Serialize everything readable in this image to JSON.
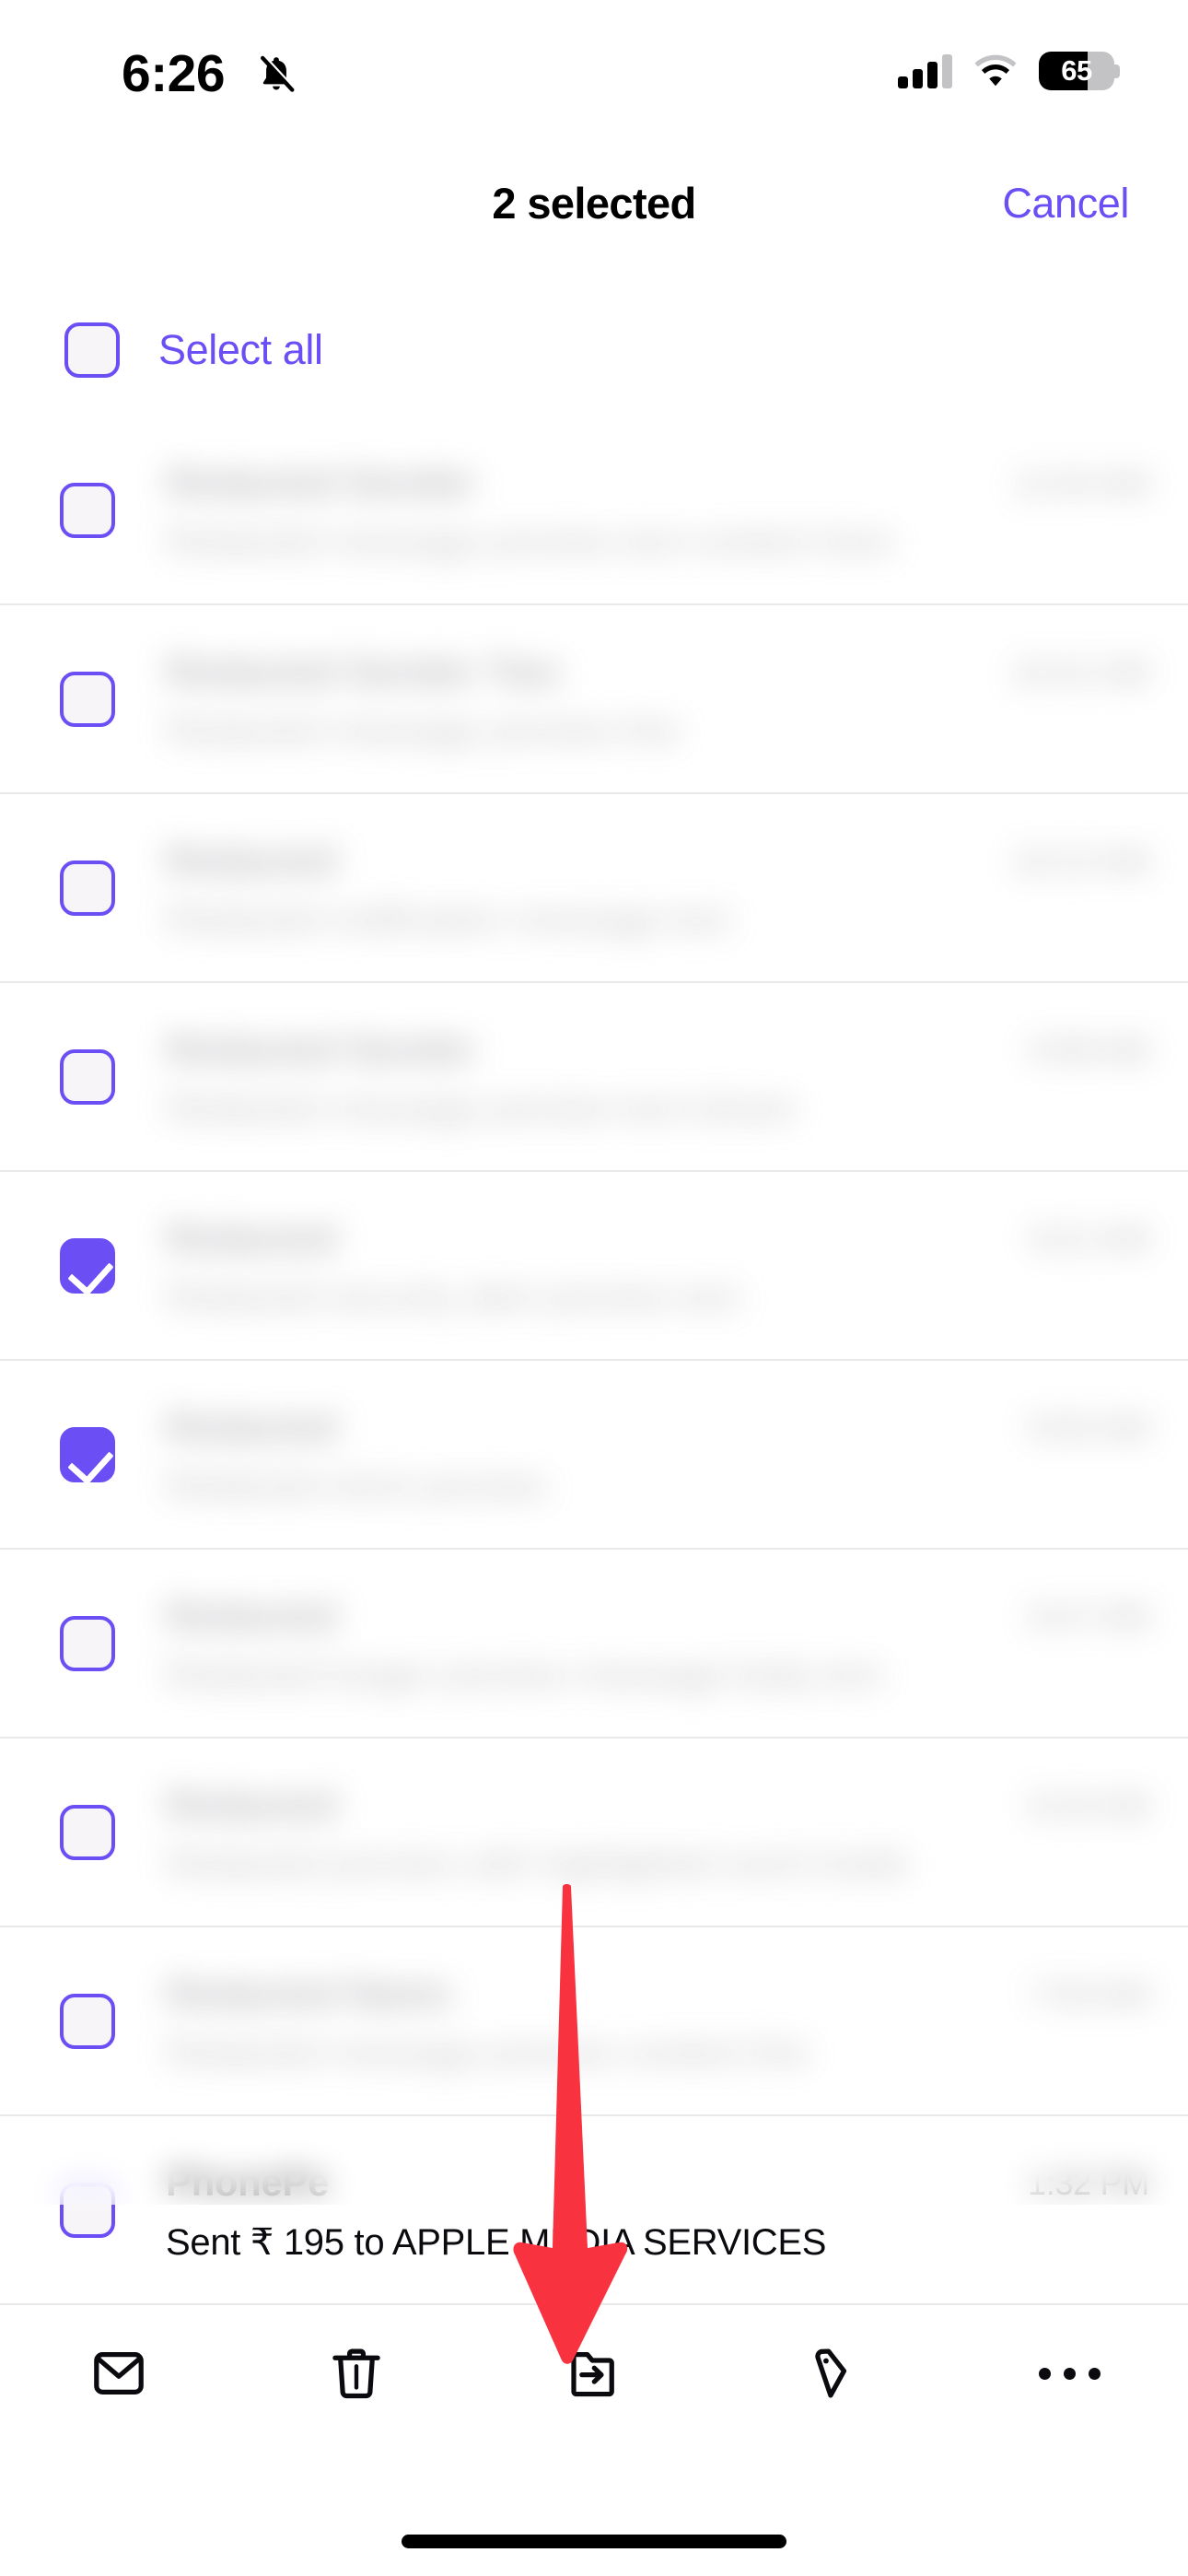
{
  "status_bar": {
    "time": "6:26",
    "bell_icon": "bell-slash-icon",
    "signal_icon": "cellular-signal-icon",
    "wifi_icon": "wifi-icon",
    "battery_percent": "65",
    "battery_level": 65
  },
  "header": {
    "title": "2 selected",
    "cancel_label": "Cancel"
  },
  "select_all": {
    "label": "Select all",
    "checked": false
  },
  "list": {
    "rows": [
      {
        "sender": "Redacted Sender",
        "preview": "Redacted message preview text content here",
        "time": "11:04 AM",
        "checked": false,
        "blurred": true
      },
      {
        "sender": "Redacted Sender Two",
        "preview": "Redacted message preview line",
        "time": "10:41 AM",
        "checked": false,
        "blurred": true
      },
      {
        "sender": "Redacted",
        "preview": "Redacted notification message text",
        "time": "10:12 AM",
        "checked": false,
        "blurred": true
      },
      {
        "sender": "Redacted Sender",
        "preview": "Redacted message preview text shown",
        "time": "9:58 AM",
        "checked": false,
        "blurred": true
      },
      {
        "sender": "Redacted",
        "preview": "Redacted security alert preview text",
        "time": "9:21 AM",
        "checked": true,
        "blurred": true
      },
      {
        "sender": "Redacted",
        "preview": "Redacted short preview",
        "time": "9:02 AM",
        "checked": true,
        "blurred": true
      },
      {
        "sender": "Redacted",
        "preview": "Redacted longer preview message body text",
        "time": "8:47 AM",
        "checked": false,
        "blurred": true
      },
      {
        "sender": "Redacted",
        "preview": "Redacted preview with highlighted word inside",
        "time": "8:15 AM",
        "checked": false,
        "blurred": true
      },
      {
        "sender": "Redacted Name",
        "preview": "Redacted message preview content line",
        "time": "7:53 AM",
        "checked": false,
        "blurred": true
      },
      {
        "sender": "PhonePe",
        "preview": "Sent ₹ 195 to  APPLE MEDIA SERVICES",
        "time": "1:32 PM",
        "checked": false,
        "blurred": false
      }
    ]
  },
  "toolbar": {
    "items": [
      {
        "icon": "envelope-icon",
        "label": "Mark as read"
      },
      {
        "icon": "trash-icon",
        "label": "Delete"
      },
      {
        "icon": "move-to-folder-icon",
        "label": "Move"
      },
      {
        "icon": "tag-icon",
        "label": "Label"
      },
      {
        "icon": "more-ellipsis-icon",
        "label": "More"
      }
    ]
  },
  "annotation": {
    "arrow_color": "#F8323F",
    "points_to": "move-to-folder-icon"
  },
  "colors": {
    "accent_purple": "#6C4EF5",
    "text_primary": "#0B0B0F",
    "separator": "#E9E9EA",
    "annotation_red": "#F8323F"
  }
}
